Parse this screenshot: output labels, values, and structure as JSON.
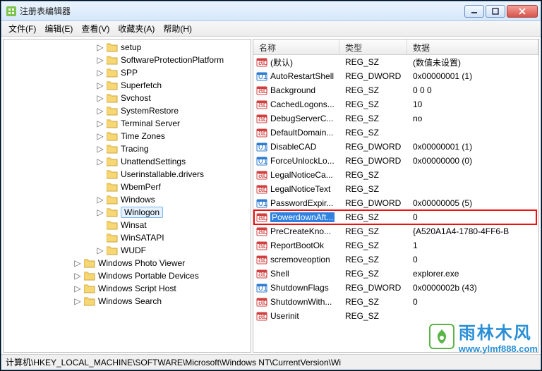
{
  "title": "注册表编辑器",
  "menu": [
    "文件(F)",
    "编辑(E)",
    "查看(V)",
    "收藏夹(A)",
    "帮助(H)"
  ],
  "statusbar": "计算机\\HKEY_LOCAL_MACHINE\\SOFTWARE\\Microsoft\\Windows NT\\CurrentVersion\\Wi",
  "tree": {
    "items": [
      {
        "label": "setup",
        "indent": 130,
        "exp": "▷"
      },
      {
        "label": "SoftwareProtectionPlatform",
        "indent": 130,
        "exp": "▷"
      },
      {
        "label": "SPP",
        "indent": 130,
        "exp": "▷"
      },
      {
        "label": "Superfetch",
        "indent": 130,
        "exp": "▷"
      },
      {
        "label": "Svchost",
        "indent": 130,
        "exp": "▷"
      },
      {
        "label": "SystemRestore",
        "indent": 130,
        "exp": "▷"
      },
      {
        "label": "Terminal Server",
        "indent": 130,
        "exp": "▷"
      },
      {
        "label": "Time Zones",
        "indent": 130,
        "exp": "▷"
      },
      {
        "label": "Tracing",
        "indent": 130,
        "exp": "▷"
      },
      {
        "label": "UnattendSettings",
        "indent": 130,
        "exp": "▷"
      },
      {
        "label": "Userinstallable.drivers",
        "indent": 130,
        "exp": ""
      },
      {
        "label": "WbemPerf",
        "indent": 130,
        "exp": ""
      },
      {
        "label": "Windows",
        "indent": 130,
        "exp": "▷"
      },
      {
        "label": "Winlogon",
        "indent": 130,
        "exp": "▷",
        "selected": true
      },
      {
        "label": "Winsat",
        "indent": 130,
        "exp": ""
      },
      {
        "label": "WinSATAPI",
        "indent": 130,
        "exp": ""
      },
      {
        "label": "WUDF",
        "indent": 130,
        "exp": "▷"
      },
      {
        "label": "Windows Photo Viewer",
        "indent": 98,
        "exp": "▷"
      },
      {
        "label": "Windows Portable Devices",
        "indent": 98,
        "exp": "▷"
      },
      {
        "label": "Windows Script Host",
        "indent": 98,
        "exp": "▷"
      },
      {
        "label": "Windows Search",
        "indent": 98,
        "exp": "▷"
      }
    ]
  },
  "list": {
    "headers": {
      "name": "名称",
      "type": "类型",
      "data": "数据"
    },
    "rows": [
      {
        "icon": "sz",
        "name": "(默认)",
        "type": "REG_SZ",
        "data": "(数值未设置)"
      },
      {
        "icon": "dw",
        "name": "AutoRestartShell",
        "type": "REG_DWORD",
        "data": "0x00000001 (1)"
      },
      {
        "icon": "sz",
        "name": "Background",
        "type": "REG_SZ",
        "data": "0 0 0"
      },
      {
        "icon": "sz",
        "name": "CachedLogons...",
        "type": "REG_SZ",
        "data": "10"
      },
      {
        "icon": "sz",
        "name": "DebugServerC...",
        "type": "REG_SZ",
        "data": "no"
      },
      {
        "icon": "sz",
        "name": "DefaultDomain...",
        "type": "REG_SZ",
        "data": ""
      },
      {
        "icon": "dw",
        "name": "DisableCAD",
        "type": "REG_DWORD",
        "data": "0x00000001 (1)"
      },
      {
        "icon": "dw",
        "name": "ForceUnlockLo...",
        "type": "REG_DWORD",
        "data": "0x00000000 (0)"
      },
      {
        "icon": "sz",
        "name": "LegalNoticeCa...",
        "type": "REG_SZ",
        "data": ""
      },
      {
        "icon": "sz",
        "name": "LegalNoticeText",
        "type": "REG_SZ",
        "data": ""
      },
      {
        "icon": "dw",
        "name": "PasswordExpir...",
        "type": "REG_DWORD",
        "data": "0x00000005 (5)"
      },
      {
        "icon": "sz",
        "name": "PowerdownAft...",
        "type": "REG_SZ",
        "data": "0",
        "selected": true,
        "boxed": true
      },
      {
        "icon": "sz",
        "name": "PreCreateKno...",
        "type": "REG_SZ",
        "data": "{A520A1A4-1780-4FF6-B"
      },
      {
        "icon": "sz",
        "name": "ReportBootOk",
        "type": "REG_SZ",
        "data": "1"
      },
      {
        "icon": "sz",
        "name": "scremoveoption",
        "type": "REG_SZ",
        "data": "0"
      },
      {
        "icon": "sz",
        "name": "Shell",
        "type": "REG_SZ",
        "data": "explorer.exe"
      },
      {
        "icon": "dw",
        "name": "ShutdownFlags",
        "type": "REG_DWORD",
        "data": "0x0000002b (43)"
      },
      {
        "icon": "sz",
        "name": "ShutdownWith...",
        "type": "REG_SZ",
        "data": "0"
      },
      {
        "icon": "sz",
        "name": "Userinit",
        "type": "REG_SZ",
        "data": ""
      }
    ]
  },
  "watermark": {
    "brand": "雨林木风",
    "url": "www.ylmf888.com"
  }
}
